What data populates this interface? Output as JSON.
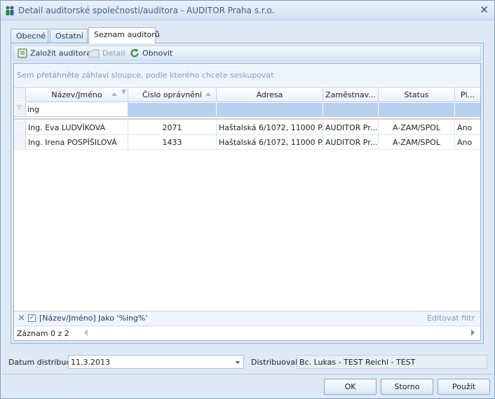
{
  "window": {
    "title": "Detail auditorské společnosti/auditora - AUDITOR Praha s.r.o.",
    "close_glyph": "✕"
  },
  "tabs": [
    {
      "label": "Obecné",
      "active": false
    },
    {
      "label": "Ostatní",
      "active": false
    },
    {
      "label": "Seznam auditorů",
      "active": true
    }
  ],
  "toolbar": {
    "create_label": "Založit auditora",
    "detail_label": "Detail",
    "refresh_label": "Obnovit"
  },
  "grid": {
    "group_hint": "Sem přetáhněte záhlaví sloupce, podle kterého chcete seskupovat",
    "columns": [
      "Název/Jméno",
      "Číslo oprávnění",
      "Adresa",
      "Zaměstnav...",
      "Status",
      "Pl..."
    ],
    "filter_value": "ing",
    "rows": [
      {
        "name": "Ing. Eva LUDVÍKOVÁ",
        "number": "2071",
        "address": "Haštalská 6/1072, 11000  P...",
        "employer": "AUDITOR Pr...",
        "status": "A-ZAM/SPOL",
        "pl": "Ano"
      },
      {
        "name": "Ing. Irena POSPÍŠILOVÁ",
        "number": "1433",
        "address": "Haštalská 6/1072, 11000  P...",
        "employer": "AUDITOR Pr...",
        "status": "A-ZAM/SPOL",
        "pl": "Ano"
      }
    ],
    "filter_expression": "[Název/Jméno] Jako '%ing%'",
    "edit_filter_label": "Editovat filtr",
    "record_info": "Záznam 0 z 2"
  },
  "bottom": {
    "date_label": "Datum distribuce",
    "date_value": "11.3.2013",
    "distributor_label": "Distribuoval",
    "distributor_value": "Bc. Lukas - TEST Reichl  - TEST"
  },
  "buttons": {
    "ok": "OK",
    "cancel": "Storno",
    "apply": "Použít"
  },
  "colors": {
    "accent": "#1e395b",
    "filter_cell": "#b9cff0",
    "refresh_icon": "#2f8a3a"
  }
}
